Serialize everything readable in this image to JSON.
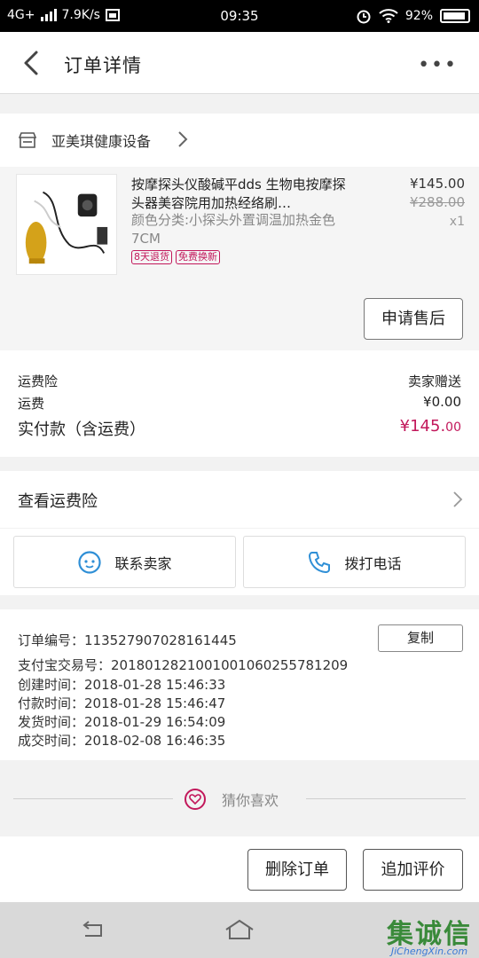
{
  "status_bar": {
    "network": "4G+",
    "speed": "7.9K/s",
    "time": "09:35",
    "battery": "92%"
  },
  "header": {
    "title": "订单详情",
    "more": "•••"
  },
  "shop": {
    "name": "亚美琪健康设备",
    "icon": "store-icon"
  },
  "product": {
    "title": "按摩探头仪酸碱平dds 生物电按摩探头器美容院用加热经络刷…",
    "spec": "颜色分类:小探头外置调温加热金色7CM",
    "tags": [
      "8天退货",
      "免费换新"
    ],
    "price": "¥145.00",
    "original_price": "¥288.00",
    "quantity": "x1",
    "after_sale_label": "申请售后"
  },
  "fees": {
    "insurance_label": "运费险",
    "insurance_value": "卖家赠送",
    "shipping_label": "运费",
    "shipping_value": "¥0.00",
    "total_label": "实付款（含运费）",
    "total_value": "¥145.",
    "total_cents": "00"
  },
  "insurance_link": {
    "label": "查看运费险"
  },
  "contacts": {
    "seller_label": "联系卖家",
    "call_label": "拨打电话"
  },
  "order_info": {
    "order_no": "订单编号：113527907028161445",
    "copy_label": "复制",
    "alipay_no": "支付宝交易号：2018012821001001060255781209",
    "created": "创建时间：2018-01-28 15:46:33",
    "paid": "付款时间：2018-01-28 15:46:47",
    "shipped": "发货时间：2018-01-29 16:54:09",
    "completed": "成交时间：2018-02-08 16:46:35"
  },
  "guess": {
    "label": "猜你喜欢"
  },
  "actions": {
    "delete_label": "删除订单",
    "review_label": "追加评价"
  },
  "watermark": {
    "brand": "集诚信",
    "url": "JiChengXin.com"
  },
  "colors": {
    "accent": "#c2185b",
    "icon_blue": "#2f8fd6"
  }
}
